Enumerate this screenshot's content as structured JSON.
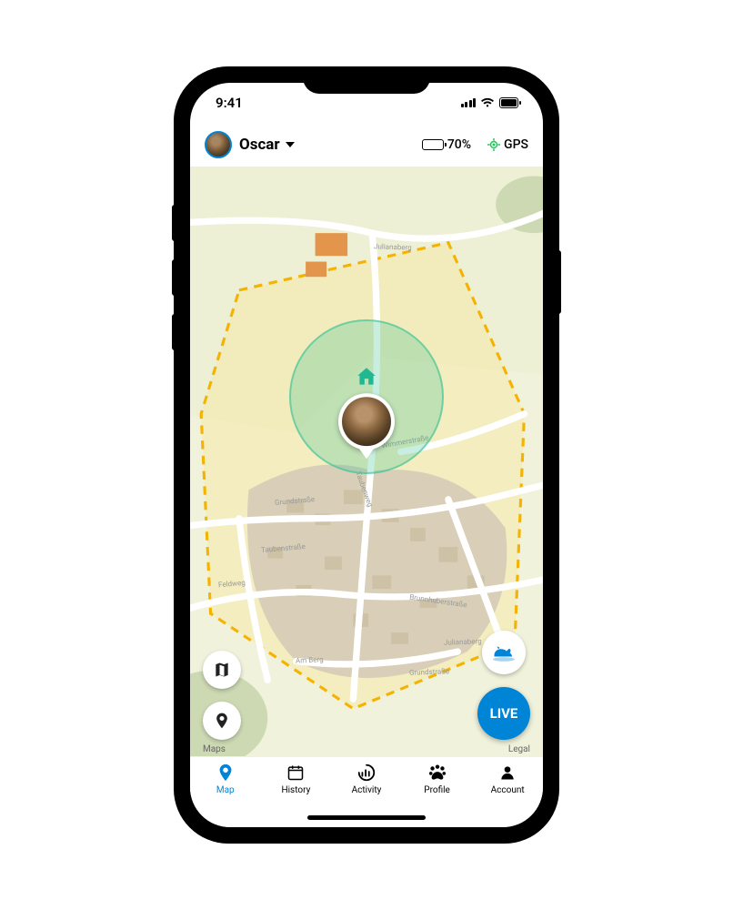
{
  "status_bar": {
    "time": "9:41"
  },
  "header": {
    "pet_name": "Oscar",
    "battery_percent": "70%",
    "gps_label": "GPS"
  },
  "map": {
    "streets": {
      "julianaberg": "Julianaberg",
      "taubenweg": "Taubenweg",
      "taubenstrasse": "Taubenstraße",
      "grundstrasse": "Grundstraße",
      "feldweg": "Feldweg",
      "amberg": "Am Berg",
      "brunnhuberstrasse": "Brunnhuberstraße",
      "wimmerstrasse": "Wimmerstraße",
      "julianaberg2": "Julianaberg",
      "grundstrasse2": "Grundstraße"
    },
    "attrib_left": "Maps",
    "attrib_right": "Legal"
  },
  "controls": {
    "live_label": "LIVE"
  },
  "nav": {
    "map": "Map",
    "history": "History",
    "activity": "Activity",
    "profile": "Profile",
    "account": "Account"
  }
}
